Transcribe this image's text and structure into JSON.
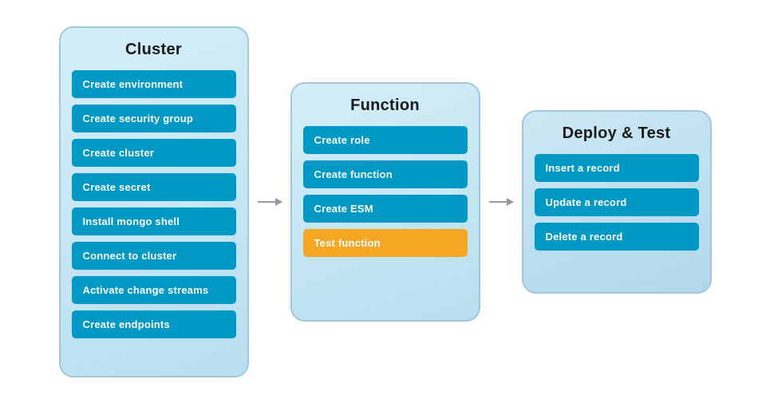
{
  "panels": {
    "cluster": {
      "title": "Cluster",
      "items": [
        {
          "label": "Create environment",
          "active": false
        },
        {
          "label": "Create security group",
          "active": false
        },
        {
          "label": "Create cluster",
          "active": false
        },
        {
          "label": "Create secret",
          "active": false
        },
        {
          "label": "Install mongo shell",
          "active": false
        },
        {
          "label": "Connect to cluster",
          "active": false
        },
        {
          "label": "Activate change streams",
          "active": false
        },
        {
          "label": "Create endpoints",
          "active": false
        }
      ]
    },
    "function": {
      "title": "Function",
      "items": [
        {
          "label": "Create role",
          "active": false
        },
        {
          "label": "Create function",
          "active": false
        },
        {
          "label": "Create ESM",
          "active": false
        },
        {
          "label": "Test function",
          "active": true
        }
      ]
    },
    "deploy": {
      "title": "Deploy & Test",
      "items": [
        {
          "label": "Insert a record",
          "active": false
        },
        {
          "label": "Update a record",
          "active": false
        },
        {
          "label": "Delete a record",
          "active": false
        }
      ]
    }
  },
  "arrows": [
    {
      "id": "arrow-1"
    },
    {
      "id": "arrow-2"
    }
  ]
}
